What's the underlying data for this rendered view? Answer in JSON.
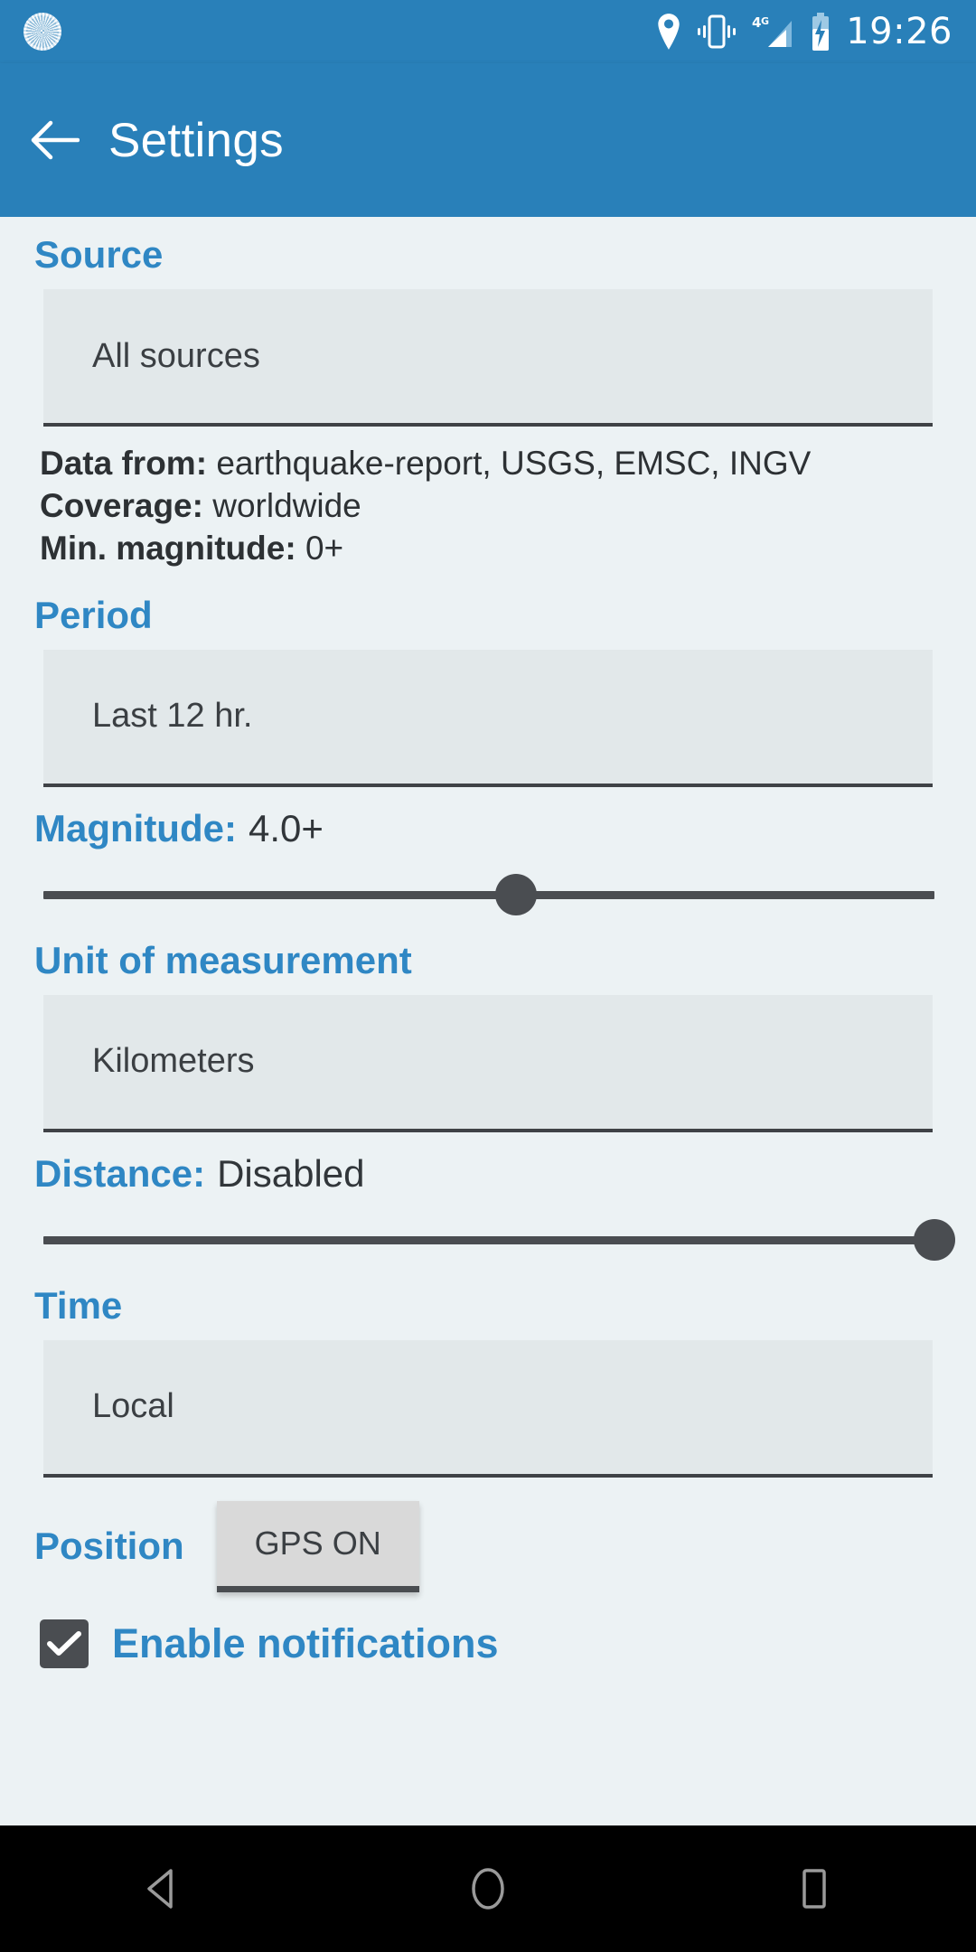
{
  "status_bar": {
    "time": "19:26",
    "icons": [
      "sunburst-icon",
      "location-pin-icon",
      "vibrate-icon",
      "signal-4g-icon",
      "battery-charging-icon"
    ],
    "network_label": "4G",
    "background_color": "#2980b9"
  },
  "app_bar": {
    "back_icon": "back-arrow-icon",
    "title": "Settings",
    "background_color": "#2980b9",
    "title_color": "#ffffff"
  },
  "theme": {
    "accent_color": "#2f87c4",
    "page_background": "#ecf2f4",
    "field_background": "#e2e8ea",
    "control_color": "#4a4d51"
  },
  "sections": {
    "source": {
      "label": "Source",
      "spinner_value": "All sources",
      "info": [
        {
          "key": "Data from:",
          "value": "earthquake-report, USGS, EMSC, INGV"
        },
        {
          "key": "Coverage:",
          "value": "worldwide"
        },
        {
          "key": "Min. magnitude:",
          "value": "0+"
        }
      ]
    },
    "period": {
      "label": "Period",
      "spinner_value": "Last 12 hr."
    },
    "magnitude": {
      "label": "Magnitude:",
      "value": "4.0+",
      "slider_percent": 53
    },
    "unit": {
      "label": "Unit of measurement",
      "spinner_value": "Kilometers"
    },
    "distance": {
      "label": "Distance:",
      "value": "Disabled",
      "slider_percent": 100
    },
    "time": {
      "label": "Time",
      "spinner_value": "Local"
    },
    "position": {
      "label": "Position",
      "button_label": "GPS ON"
    },
    "notifications": {
      "label": "Enable notifications",
      "checked": true
    }
  },
  "nav_bar": {
    "back_label": "back-triangle-icon",
    "home_label": "home-circle-icon",
    "recents_label": "recents-square-icon",
    "background_color": "#000000"
  }
}
